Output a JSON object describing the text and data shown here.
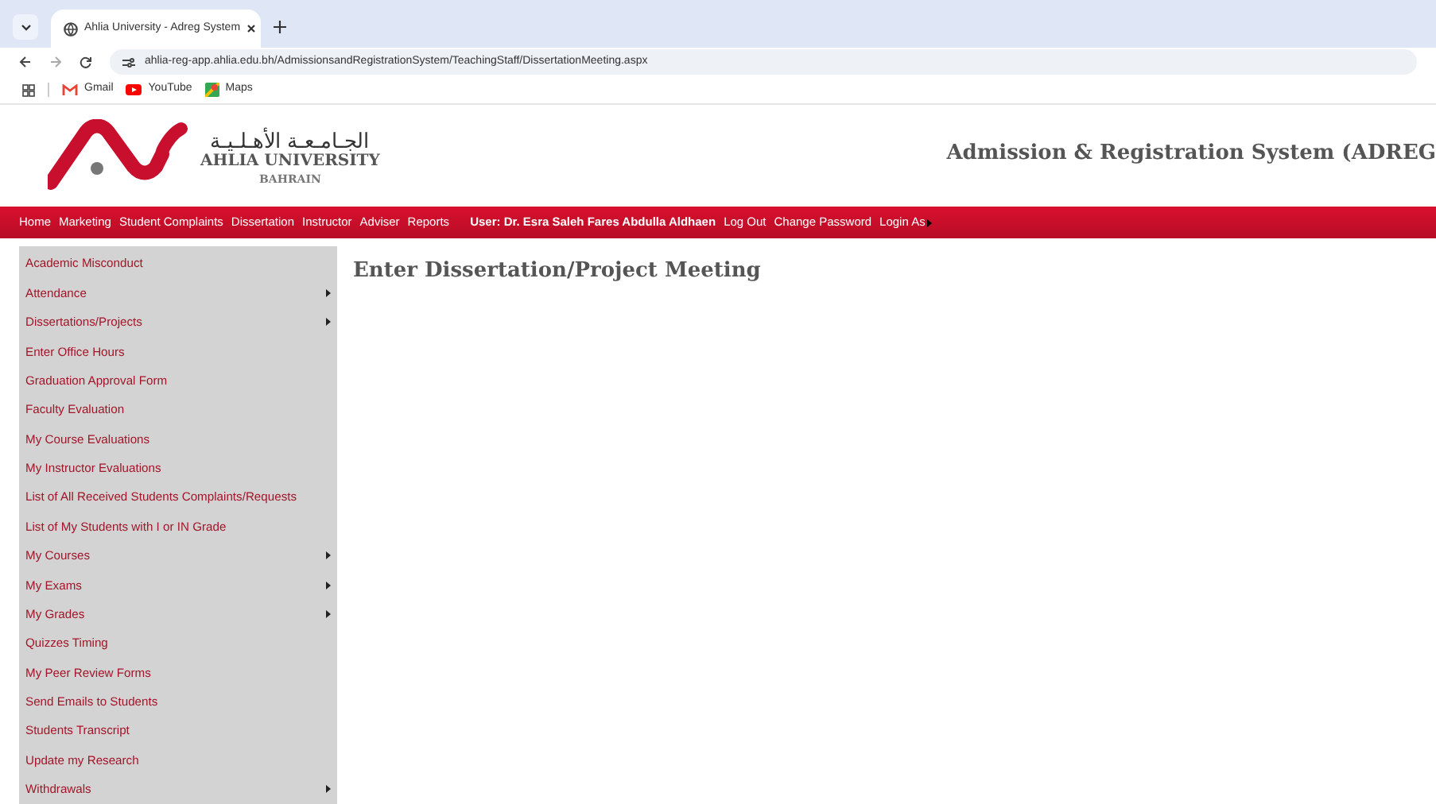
{
  "browser": {
    "tab_title": "Ahlia University - Adreg System",
    "url": "ahlia-reg-app.ahlia.edu.bh/AdmissionsandRegistrationSystem/TeachingStaff/DissertationMeeting.aspx",
    "bookmarks": [
      {
        "label": "Gmail",
        "kind": "gmail"
      },
      {
        "label": "YouTube",
        "kind": "youtube"
      },
      {
        "label": "Maps",
        "kind": "maps"
      }
    ]
  },
  "header": {
    "arabic_name": "الجـامـعـة الأهـلـيـة",
    "english_name": "AHLIA UNIVERSITY",
    "country": "BAHRAIN",
    "system_title": "Admission & Registration System (ADREG"
  },
  "nav": [
    {
      "label": "Home",
      "kind": "link",
      "submenu": false
    },
    {
      "label": "Marketing",
      "kind": "link",
      "submenu": false
    },
    {
      "label": "Student Complaints",
      "kind": "link",
      "submenu": false
    },
    {
      "label": "Dissertation",
      "kind": "link",
      "submenu": false
    },
    {
      "label": "Instructor",
      "kind": "link",
      "submenu": false
    },
    {
      "label": "Adviser",
      "kind": "link",
      "submenu": false
    },
    {
      "label": "Reports",
      "kind": "link",
      "submenu": false
    },
    {
      "label": "User: Dr. Esra Saleh Fares Abdulla Aldhaen",
      "kind": "user"
    },
    {
      "label": "Log Out",
      "kind": "link",
      "submenu": false
    },
    {
      "label": "Change Password",
      "kind": "link",
      "submenu": false
    },
    {
      "label": "Login As",
      "kind": "link",
      "submenu": true
    }
  ],
  "sidebar": [
    {
      "label": "Academic Misconduct",
      "submenu": false
    },
    {
      "label": "Attendance",
      "submenu": true
    },
    {
      "label": "Dissertations/Projects",
      "submenu": true
    },
    {
      "label": "Enter Office Hours",
      "submenu": false
    },
    {
      "label": "Graduation Approval Form",
      "submenu": false
    },
    {
      "label": "Faculty Evaluation",
      "submenu": false
    },
    {
      "label": "My Course Evaluations",
      "submenu": false
    },
    {
      "label": "My Instructor Evaluations",
      "submenu": false
    },
    {
      "label": "List of All Received Students Complaints/Requests",
      "submenu": false
    },
    {
      "label": "List of My Students with I or IN Grade",
      "submenu": false
    },
    {
      "label": "My Courses",
      "submenu": true
    },
    {
      "label": "My Exams",
      "submenu": true
    },
    {
      "label": "My Grades",
      "submenu": true
    },
    {
      "label": "Quizzes Timing",
      "submenu": false
    },
    {
      "label": "My Peer Review Forms",
      "submenu": false
    },
    {
      "label": "Send Emails to Students",
      "submenu": false
    },
    {
      "label": "Students Transcript",
      "submenu": false
    },
    {
      "label": "Update my Research",
      "submenu": false
    },
    {
      "label": "Withdrawals",
      "submenu": true
    }
  ],
  "page_title": "Enter Dissertation/Project Meeting"
}
